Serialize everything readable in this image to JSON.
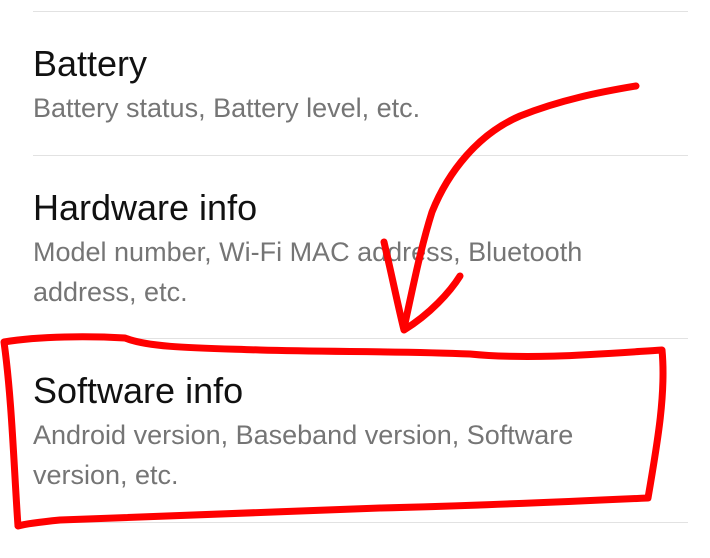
{
  "settings": {
    "items": [
      {
        "title": "Battery",
        "summary": "Battery status, Battery level, etc."
      },
      {
        "title": "Hardware info",
        "summary": "Model number, Wi-Fi MAC address, Bluetooth address, etc."
      },
      {
        "title": "Software info",
        "summary": "Android version, Baseband version, Software version, etc."
      }
    ]
  },
  "colors": {
    "annotation": "#ff0000",
    "title_text": "#111111",
    "summary_text": "#757575",
    "divider": "#e2e2e2"
  }
}
